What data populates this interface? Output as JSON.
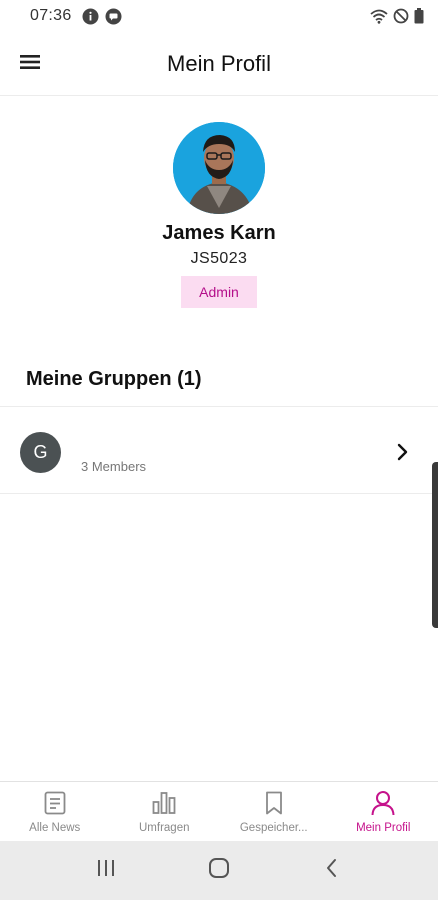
{
  "status_bar": {
    "time": "07:36",
    "icons": [
      "info-icon",
      "message-icon",
      "wifi-icon",
      "do-not-disturb-icon",
      "battery-icon"
    ]
  },
  "header": {
    "title": "Mein Profil",
    "menu_icon": "hamburger-menu-icon"
  },
  "profile": {
    "name": "James Karn",
    "id": "JS5023",
    "role": "Admin",
    "avatar_bg": "#1aa3de"
  },
  "groups": {
    "heading": "Meine Gruppen (1)",
    "items": [
      {
        "initial": "G",
        "members": "3 Members"
      }
    ]
  },
  "bottom_nav": {
    "items": [
      {
        "label": "Alle News",
        "icon": "news-icon",
        "active": false
      },
      {
        "label": "Umfragen",
        "icon": "bar-chart-icon",
        "active": false
      },
      {
        "label": "Gespeicher...",
        "icon": "bookmark-icon",
        "active": false
      },
      {
        "label": "Mein Profil",
        "icon": "person-icon",
        "active": true
      }
    ]
  },
  "system_nav": {
    "buttons": [
      "recent-apps-icon",
      "home-icon",
      "back-icon"
    ]
  },
  "colors": {
    "accent": "#c5128b",
    "badge_bg": "#fbdcf1",
    "group_avatar": "#4b5153"
  }
}
